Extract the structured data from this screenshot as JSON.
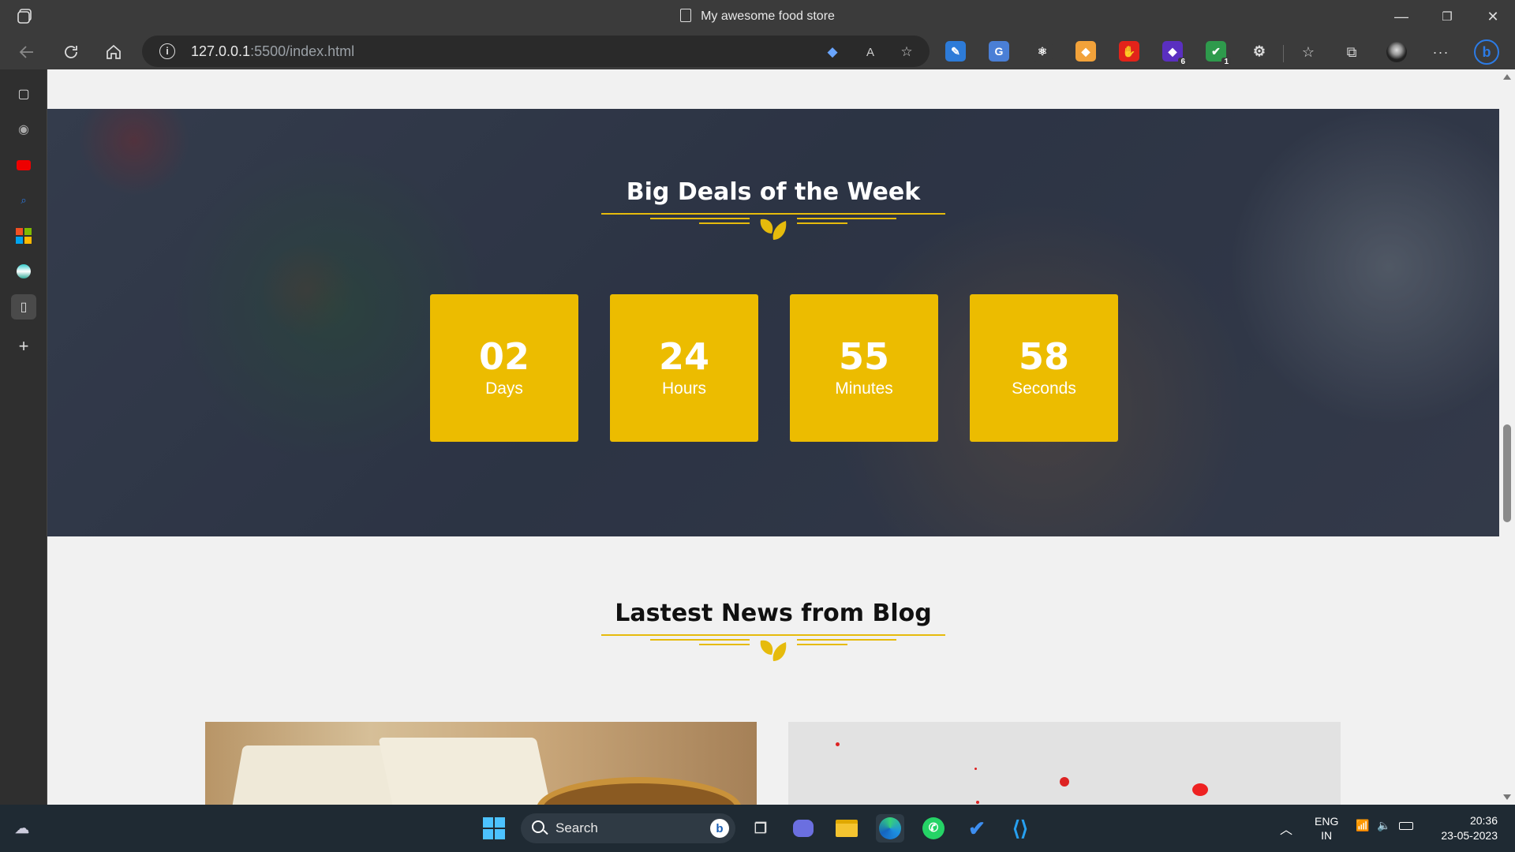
{
  "browser": {
    "window_title": "My awesome food store",
    "url_host": "127.0.0.1",
    "url_rest": ":5500/index.html",
    "controls": {
      "minimize": "—",
      "restore": "❐",
      "close": "✕"
    },
    "extensions": [
      {
        "name": "pen-extension-icon",
        "glyph": "✎",
        "color": "#2d7bd8",
        "badge": ""
      },
      {
        "name": "translate-extension-icon",
        "glyph": "G",
        "color": "#4a7fd6",
        "badge": ""
      },
      {
        "name": "react-devtools-icon",
        "glyph": "⚛",
        "color": "#3b3b3b",
        "badge": ""
      },
      {
        "name": "orange-extension-icon",
        "glyph": "◆",
        "color": "#f2a23a",
        "badge": ""
      },
      {
        "name": "red-hand-extension-icon",
        "glyph": "✋",
        "color": "#e2231a",
        "badge": ""
      },
      {
        "name": "purple-extension-icon",
        "glyph": "◆",
        "color": "#5a2fc0",
        "badge": "6"
      },
      {
        "name": "shield-extension-icon",
        "glyph": "✔",
        "color": "#2e9a4c",
        "badge": "1"
      }
    ]
  },
  "deals": {
    "title": "Big Deals of the Week",
    "countdown": [
      {
        "value": "02",
        "label": "Days"
      },
      {
        "value": "24",
        "label": "Hours"
      },
      {
        "value": "55",
        "label": "Minutes"
      },
      {
        "value": "58",
        "label": "Seconds"
      }
    ]
  },
  "blog": {
    "title": "Lastest News from Blog"
  },
  "taskbar": {
    "search_label": "Search",
    "lang_top": "ENG",
    "lang_bottom": "IN",
    "time": "20:36",
    "date": "23-05-2023"
  },
  "colors": {
    "accent": "#ecbc00",
    "titlebar": "#3b3b3b",
    "taskbar": "#1f2a33"
  }
}
